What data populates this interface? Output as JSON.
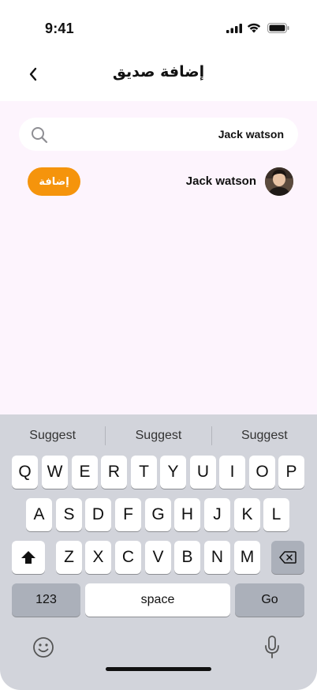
{
  "status_bar": {
    "time": "9:41"
  },
  "header": {
    "title": "إضافة صديق"
  },
  "search": {
    "value": "Jack watson",
    "placeholder": ""
  },
  "results": [
    {
      "name": "Jack watson",
      "action_label": "إضافة"
    }
  ],
  "colors": {
    "accent": "#f5940c",
    "content_bg": "#fdf4fd",
    "keyboard_bg": "#d2d4db"
  },
  "keyboard": {
    "suggestions": [
      "Suggest",
      "Suggest",
      "Suggest"
    ],
    "row1": [
      "Q",
      "W",
      "E",
      "R",
      "T",
      "Y",
      "U",
      "I",
      "O",
      "P"
    ],
    "row2": [
      "A",
      "S",
      "D",
      "F",
      "G",
      "H",
      "J",
      "K",
      "L"
    ],
    "row3": [
      "Z",
      "X",
      "C",
      "V",
      "B",
      "N",
      "M"
    ],
    "numbers_label": "123",
    "space_label": "space",
    "go_label": "Go"
  },
  "icons": [
    "signal-icon",
    "wifi-icon",
    "battery-icon",
    "chevron-left-icon",
    "search-icon",
    "shift-icon",
    "backspace-icon",
    "emoji-icon",
    "microphone-icon"
  ]
}
